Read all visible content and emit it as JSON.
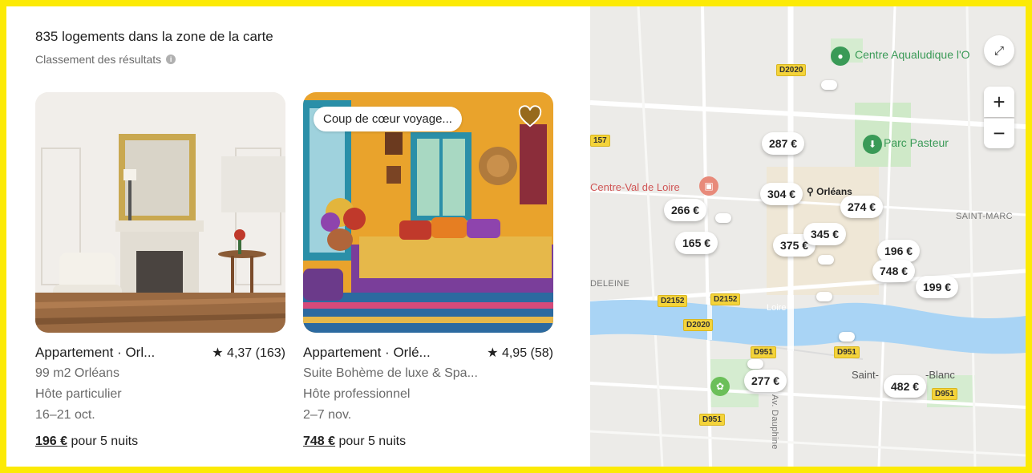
{
  "header": {
    "count": "835 logements dans la zone de la carte",
    "sort_label": "Classement des résultats"
  },
  "listings": [
    {
      "title": "Appartement · Orl...",
      "rating": "★ 4,37 (163)",
      "subtitle": "99 m2 Orléans",
      "host": "Hôte particulier",
      "dates": "16–21 oct.",
      "price": "196 €",
      "price_suffix": " pour 5 nuits"
    },
    {
      "badge": "Coup de cœur voyage...",
      "title": "Appartement · Orlé...",
      "rating": "★ 4,95 (58)",
      "subtitle": "Suite Bohème de luxe & Spa...",
      "host": "Hôte professionnel",
      "dates": "2–7 nov.",
      "price": "748 €",
      "price_suffix": " pour 5 nuits"
    }
  ],
  "map": {
    "price_pins": [
      "287 €",
      "304 €",
      "266 €",
      "274 €",
      "165 €",
      "375 €",
      "345 €",
      "196 €",
      "748 €",
      "199 €",
      "277 €",
      "482 €"
    ],
    "places": {
      "aqualudique": "Centre Aqualudique l'O",
      "parc": "Parc Pasteur",
      "cvl": "Centre-Val de Loire",
      "orleans": "Orléans",
      "saint_marc": "SAINT-MARC",
      "madeleine": "DELEINE",
      "loire": "Loire",
      "saint_blanc": "Saint-",
      "saint_blanc2": "-Blanc",
      "dauphine": "Av. Dauphine"
    },
    "roads": [
      "D2020",
      "157",
      "D2152",
      "D2152",
      "D2020",
      "D951",
      "D951",
      "D951",
      "D951"
    ],
    "controls": {
      "expand": "⤢",
      "zoom_in": "+",
      "zoom_out": "−"
    }
  },
  "colors": {
    "accent_highlight": "#FCEA05",
    "river": "#a9d4f5",
    "park": "#c6e6c0"
  }
}
